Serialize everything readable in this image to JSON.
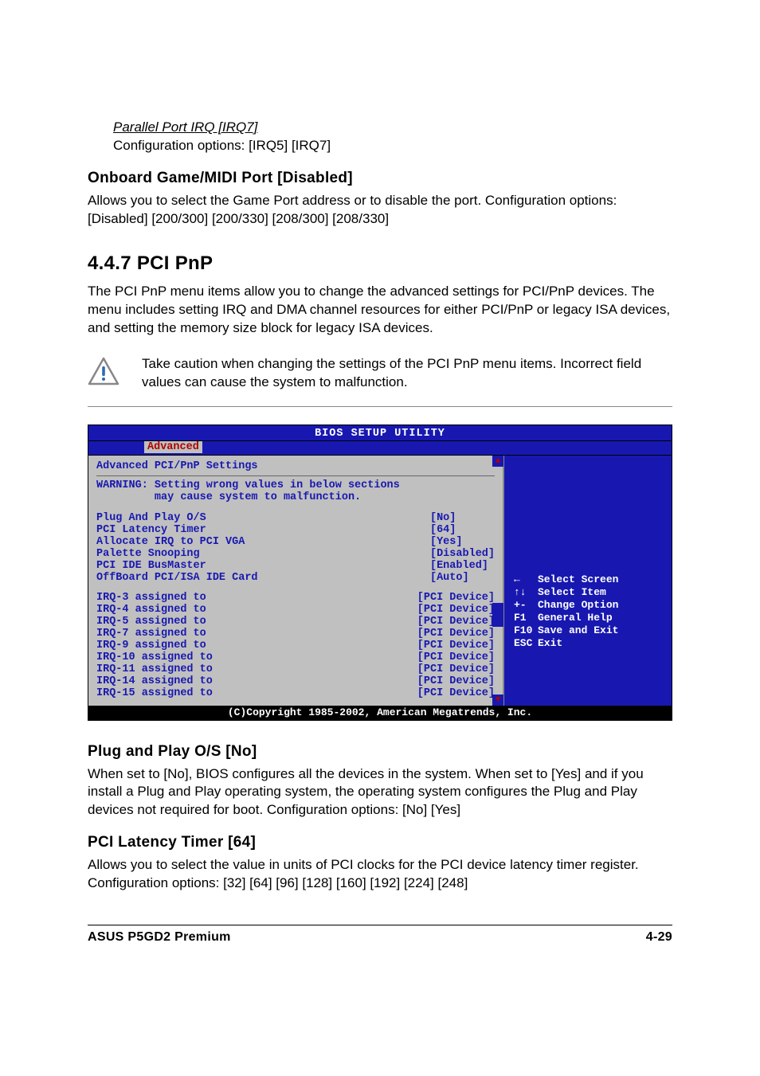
{
  "parallel_port": {
    "title": "Parallel Port IRQ [IRQ7]",
    "body": "Configuration options: [IRQ5] [IRQ7]"
  },
  "onboard_game": {
    "title": "Onboard Game/MIDI Port [Disabled]",
    "body": "Allows you to select the Game Port address or to disable the port. Configuration options: [Disabled] [200/300] [200/330] [208/300] [208/330]"
  },
  "pci_pnp": {
    "heading": "4.4.7   PCI PnP",
    "intro": "The PCI PnP menu items allow you to change the advanced settings for PCI/PnP devices. The menu includes setting IRQ and DMA channel resources for either PCI/PnP or legacy ISA devices, and setting the memory size block for legacy ISA devices.",
    "caution": "Take caution when changing the settings of the PCI PnP menu items. Incorrect field values can cause the system to malfunction."
  },
  "bios": {
    "title": "BIOS SETUP UTILITY",
    "tab": "Advanced",
    "panel_title": "Advanced PCI/PnP Settings",
    "warning_l1": "WARNING: Setting wrong values in below sections",
    "warning_l2": "         may cause system to malfunction.",
    "rows1": [
      {
        "label": "Plug And Play O/S",
        "value": "[No]"
      },
      {
        "label": "PCI Latency Timer",
        "value": "[64]"
      },
      {
        "label": "Allocate IRQ to PCI VGA",
        "value": "[Yes]"
      },
      {
        "label": "Palette Snooping",
        "value": "[Disabled]"
      },
      {
        "label": "PCI IDE BusMaster",
        "value": "[Enabled]"
      },
      {
        "label": "OffBoard PCI/ISA IDE Card",
        "value": "[Auto]"
      }
    ],
    "rows2": [
      {
        "label": "IRQ-3 assigned to",
        "value": "[PCI Device]"
      },
      {
        "label": "IRQ-4 assigned to",
        "value": "[PCI Device]"
      },
      {
        "label": "IRQ-5 assigned to",
        "value": "[PCI Device]"
      },
      {
        "label": "IRQ-7 assigned to",
        "value": "[PCI Device]"
      },
      {
        "label": "IRQ-9 assigned to",
        "value": "[PCI Device]"
      },
      {
        "label": "IRQ-10 assigned to",
        "value": "[PCI Device]"
      },
      {
        "label": "IRQ-11 assigned to",
        "value": "[PCI Device]"
      },
      {
        "label": "IRQ-14 assigned to",
        "value": "[PCI Device]"
      },
      {
        "label": "IRQ-15 assigned to",
        "value": "[PCI Device]"
      }
    ],
    "nav": [
      {
        "key": "←",
        "label": "Select Screen"
      },
      {
        "key": "↑↓",
        "label": "Select Item"
      },
      {
        "key": "+-",
        "label": "Change Option"
      },
      {
        "key": "F1",
        "label": "General Help"
      },
      {
        "key": "F10",
        "label": "Save and Exit"
      },
      {
        "key": "ESC",
        "label": "Exit"
      }
    ],
    "copyright": "(C)Copyright 1985-2002, American Megatrends, Inc."
  },
  "plug_play": {
    "title": "Plug and Play O/S [No]",
    "body": "When set to [No], BIOS configures all the devices in the system. When set to [Yes] and if you install a Plug and Play operating system, the operating system configures the Plug and Play devices not required for boot. Configuration options: [No] [Yes]"
  },
  "pci_latency": {
    "title": "PCI Latency Timer [64]",
    "body": "Allows you to select the value in units of PCI clocks for the PCI device latency timer register. Configuration options: [32] [64] [96] [128] [160] [192] [224] [248]"
  },
  "footer": {
    "left": "ASUS P5GD2 Premium",
    "right": "4-29"
  }
}
